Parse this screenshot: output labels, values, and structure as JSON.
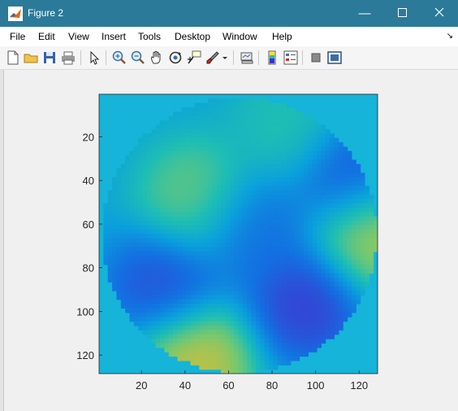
{
  "window": {
    "title": "Figure 2",
    "app_icon": "matlab-icon",
    "controls": [
      "minimize-icon",
      "maximize-icon",
      "close-icon"
    ],
    "titlebar_color": "#2b7a99"
  },
  "menu": {
    "items": [
      "File",
      "Edit",
      "View",
      "Insert",
      "Tools",
      "Desktop",
      "Window",
      "Help"
    ]
  },
  "toolbar": {
    "icons": [
      "new-figure-icon",
      "open-file-icon",
      "save-icon",
      "print-icon",
      "select-arrow-icon",
      "zoom-in-icon",
      "zoom-out-icon",
      "pan-hand-icon",
      "rotate-3d-icon",
      "data-cursor-icon",
      "brush-icon",
      "brush-dropdown-icon",
      "link-plot-icon",
      "insert-colorbar-icon",
      "insert-legend-icon",
      "hide-plot-tools-icon",
      "show-plot-tools-icon"
    ]
  },
  "chart_data": {
    "type": "heatmap",
    "title": "",
    "xlabel": "",
    "ylabel": "",
    "xlim": [
      0.5,
      128.5
    ],
    "ylim": [
      0.5,
      128.5
    ],
    "y_direction": "reverse",
    "xticks": [
      20,
      40,
      60,
      80,
      100,
      120
    ],
    "yticks": [
      20,
      40,
      60,
      80,
      100,
      120
    ],
    "grid": false,
    "colormap": "parula",
    "colors": {
      "background_level": "#15b4d8",
      "low": "#3a2fd6",
      "high": "#f9e32a"
    },
    "note_values": [
      {
        "x": 45,
        "y": 48,
        "level": 0.75
      },
      {
        "x": 30,
        "y": 88,
        "level": 0.1
      },
      {
        "x": 95,
        "y": 97,
        "level": 0.05
      },
      {
        "x": 70,
        "y": 62,
        "level": 0.2
      },
      {
        "x": 117,
        "y": 38,
        "level": 0.1
      },
      {
        "x": 45,
        "y": 122,
        "level": 0.95
      },
      {
        "x": 127,
        "y": 64,
        "level": 0.9
      },
      {
        "x": 88,
        "y": 15,
        "level": 0.6
      }
    ]
  }
}
